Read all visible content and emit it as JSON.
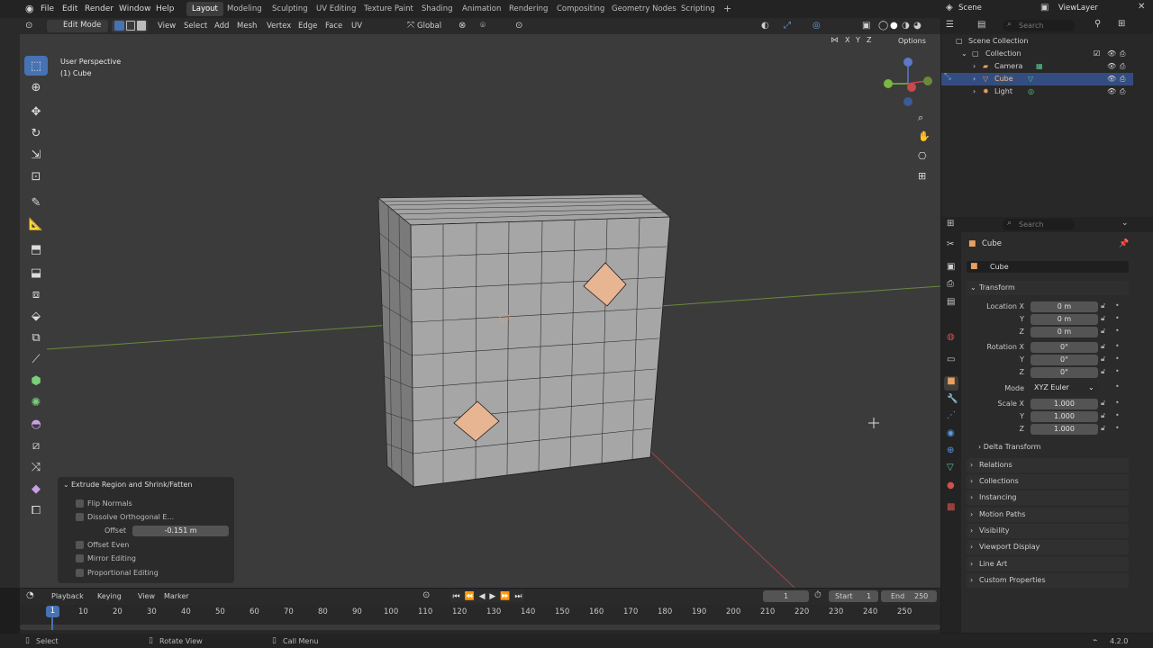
{
  "menubar": {
    "menus": [
      "File",
      "Edit",
      "Render",
      "Window",
      "Help"
    ],
    "workspaces": [
      "Layout",
      "Modeling",
      "Sculpting",
      "UV Editing",
      "Texture Paint",
      "Shading",
      "Animation",
      "Rendering",
      "Compositing",
      "Geometry Nodes",
      "Scripting"
    ],
    "active_workspace": "Layout",
    "scene": "Scene",
    "view_layer": "ViewLayer"
  },
  "viewport_header": {
    "mode": "Edit Mode",
    "menus": [
      "View",
      "Select",
      "Add",
      "Mesh",
      "Vertex",
      "Edge",
      "Face",
      "UV"
    ],
    "orientation": "Global",
    "axes": [
      "X",
      "Y",
      "Z"
    ],
    "options": "Options"
  },
  "viewport": {
    "perspective": "User Perspective",
    "object": "(1) Cube"
  },
  "operator_panel": {
    "title": "Extrude Region and Shrink/Fatten",
    "flip_normals": "Flip Normals",
    "dissolve": "Dissolve Orthogonal E...",
    "offset_label": "Offset",
    "offset_value": "-0.151 m",
    "offset_even": "Offset Even",
    "mirror_editing": "Mirror Editing",
    "proportional_editing": "Proportional Editing"
  },
  "outliner": {
    "search_placeholder": "Search",
    "items": [
      {
        "label": "Scene Collection"
      },
      {
        "label": "Collection"
      },
      {
        "label": "Camera"
      },
      {
        "label": "Cube"
      },
      {
        "label": "Light"
      }
    ]
  },
  "properties": {
    "search_placeholder": "Search",
    "object_name": "Cube",
    "object_field": "Cube",
    "transform": {
      "title": "Transform",
      "location_label": "Location X",
      "location": [
        "0 m",
        "0 m",
        "0 m"
      ],
      "rotation_label": "Rotation X",
      "rotation": [
        "0°",
        "0°",
        "0°"
      ],
      "mode_label": "Mode",
      "mode": "XYZ Euler",
      "scale_label": "Scale X",
      "scale": [
        "1.000",
        "1.000",
        "1.000"
      ],
      "y_label": "Y",
      "z_label": "Z",
      "delta": "Delta Transform"
    },
    "sections": [
      "Relations",
      "Collections",
      "Instancing",
      "Motion Paths",
      "Visibility",
      "Viewport Display",
      "Line Art",
      "Custom Properties"
    ]
  },
  "timeline": {
    "menus": [
      "Playback",
      "Keying",
      "View",
      "Marker"
    ],
    "current_frame": "1",
    "start_label": "Start",
    "start": "1",
    "end_label": "End",
    "end": "250",
    "ticks": [
      "1",
      "10",
      "20",
      "30",
      "40",
      "50",
      "60",
      "70",
      "80",
      "90",
      "100",
      "110",
      "120",
      "130",
      "140",
      "150",
      "160",
      "170",
      "180",
      "190",
      "200",
      "210",
      "220",
      "230",
      "240",
      "250"
    ]
  },
  "statusbar": {
    "select": "Select",
    "rotate": "Rotate View",
    "call_menu": "Call Menu",
    "version": "4.2.0"
  },
  "colors": {
    "accent": "#4772b3",
    "selected_row": "#334d80",
    "face_selected": "#e8b592"
  }
}
